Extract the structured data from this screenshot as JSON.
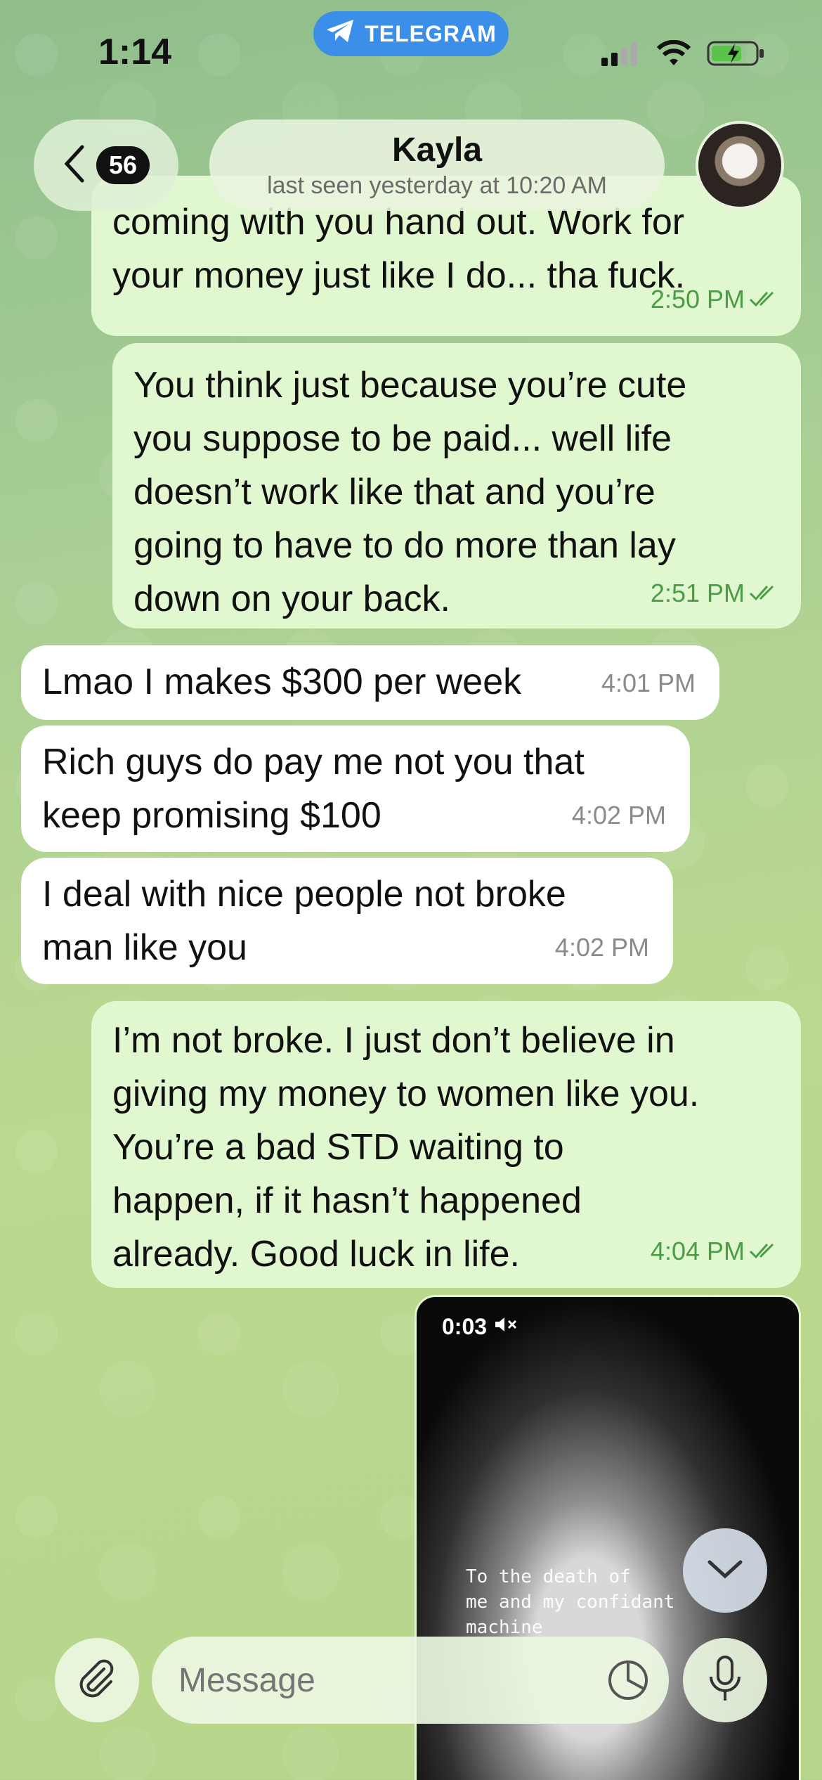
{
  "status_bar": {
    "time": "1:14",
    "app_pill": "TELEGRAM"
  },
  "header": {
    "back_count": "56",
    "contact_name": "Kayla",
    "last_seen": "last seen yesterday at 10:20 AM"
  },
  "messages": [
    {
      "direction": "out",
      "text": "coming with you hand out. Work for\nyour money just like I do... tha fuck.",
      "time": "2:50 PM"
    },
    {
      "direction": "out",
      "text": "You think just because you’re cute\nyou suppose to be paid... well life\ndoesn’t work like that and you’re\ngoing to have to do more than lay\ndown on your back.",
      "time": "2:51 PM"
    },
    {
      "direction": "in",
      "text": "Lmao I makes $300 per week",
      "time": "4:01 PM"
    },
    {
      "direction": "in",
      "text": "Rich guys do pay me not you that\nkeep promising $100",
      "time": "4:02 PM"
    },
    {
      "direction": "in",
      "text": "I deal with nice people not broke\nman like you",
      "time": "4:02 PM"
    },
    {
      "direction": "out",
      "text": "I’m not broke. I just don’t believe in\ngiving my money to women like you.\nYou’re a bad STD waiting to\nhappen, if it hasn’t happened\nalready. Good luck in life.",
      "time": "4:04 PM"
    }
  ],
  "video_message": {
    "duration": "0:03",
    "caption": "To the death of\nme and my confidant\nmachine"
  },
  "composer": {
    "placeholder": "Message"
  },
  "colors": {
    "outgoing_bubble": "#e1f7cf",
    "incoming_bubble": "#ffffff",
    "outgoing_time": "#4a9d44",
    "telegram_blue": "#3b8fe8"
  }
}
